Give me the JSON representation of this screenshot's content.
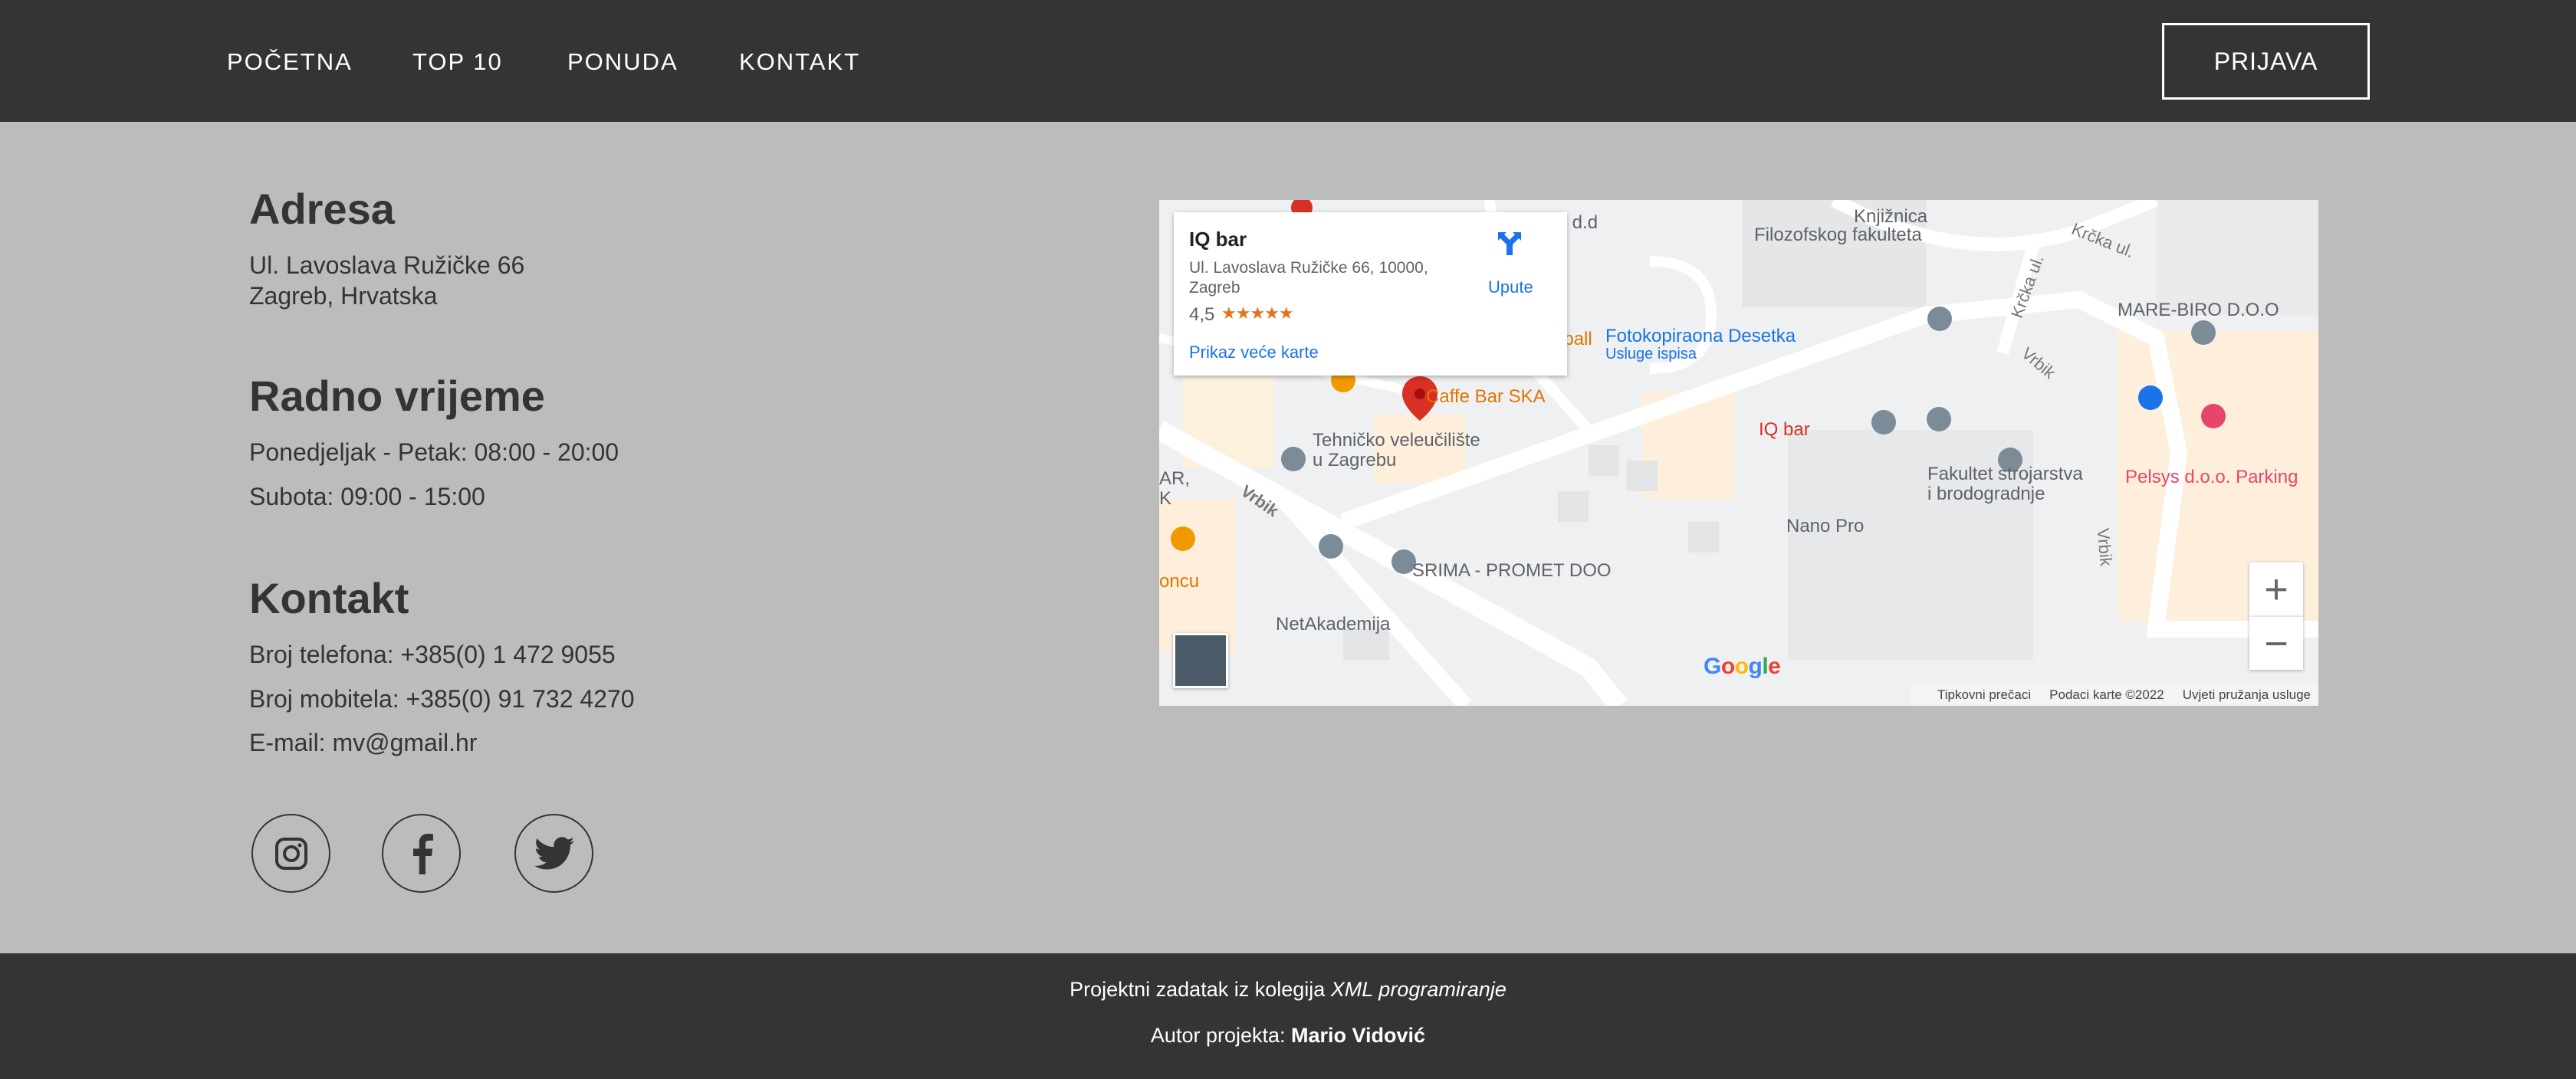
{
  "nav": {
    "items": [
      "POČETNA",
      "TOP 10",
      "PONUDA",
      "KONTAKT"
    ],
    "login": "PRIJAVA"
  },
  "address": {
    "heading": "Adresa",
    "line1": "Ul. Lavoslava Ružičke 66",
    "line2": "Zagreb, Hrvatska"
  },
  "hours": {
    "heading": "Radno vrijeme",
    "weekdays": "Ponedjeljak - Petak: 08:00 - 20:00",
    "saturday": "Subota: 09:00 - 15:00"
  },
  "contact": {
    "heading": "Kontakt",
    "phone": "Broj telefona: +385(0) 1 472 9055",
    "mobile": "Broj mobitela: +385(0) 91 732 4270",
    "email": "E-mail: mv@gmail.hr"
  },
  "social": [
    "instagram-icon",
    "facebook-icon",
    "twitter-icon"
  ],
  "map": {
    "card": {
      "title": "IQ bar",
      "address": "Ul. Lavoslava Ružičke 66, 10000, Zagreb",
      "rating": "4,5",
      "stars": "★★★★★",
      "directions": "Upute",
      "larger_map": "Prikaz veće karte"
    },
    "labels": {
      "knjiznica": "Knjižnica",
      "filozofski": "Filozofskog fakulteta",
      "krcka1": "Krčka ul.",
      "krcka2": "Krčka ul.",
      "marebiro": "MARE-BIRO D.O.O",
      "sdd": "S d.d",
      "eball": "eball",
      "fotokopiraona": "Fotokopiraona Desetka",
      "usluge": "Usluge ispisa",
      "caffe": "Caffe Bar SKA",
      "iqbar": "IQ bar",
      "tehnicko1": "Tehničko veleučilište",
      "tehnicko2": "u Zagrebu",
      "fakultet1": "Fakultet strojarstva",
      "fakultet2": "i brodogradnje",
      "pelsys": "Pelsys d.o.o. Parking",
      "nano": "Nano Pro",
      "vrbik1": "Vrbik",
      "vrbik2": "Vrbik",
      "vrbik3": "Vrbik",
      "ar": "AR,",
      "k": "K",
      "srima": "SRIMA - PROMET DOO",
      "netakademija": "NetAkademija",
      "oncu": "oncu"
    },
    "zoom_in": "+",
    "zoom_out": "−",
    "google": [
      "G",
      "o",
      "o",
      "g",
      "l",
      "e"
    ],
    "google_colors": [
      "#4285F4",
      "#EA4335",
      "#FBBC05",
      "#4285F4",
      "#34A853",
      "#EA4335"
    ],
    "attribution": [
      "Tipkovni prečaci",
      "Podaci karte ©2022",
      "Uvjeti pružanja usluge"
    ]
  },
  "footer": {
    "line1_prefix": "Projektni zadatak iz kolegija ",
    "line1_course": "XML programiranje",
    "line2_prefix": "Autor projekta: ",
    "line2_author": "Mario Vidović"
  },
  "colors": {
    "header_bg": "#343434",
    "body_bg": "#bcbcbc",
    "pin_red": "#d93025",
    "link_blue": "#1a73e8"
  }
}
